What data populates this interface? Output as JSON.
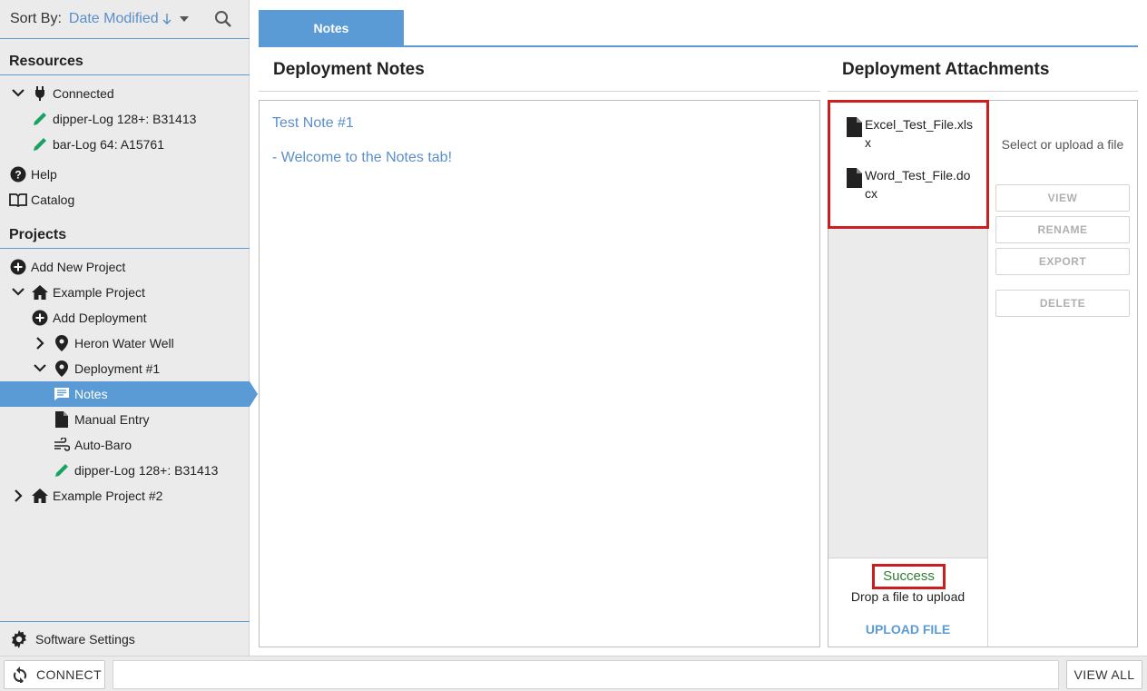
{
  "sidebar": {
    "sort": {
      "label": "Sort By:",
      "value": "Date Modified"
    },
    "resources_title": "Resources",
    "resources": [
      {
        "label": "Connected",
        "icon": "plug-icon",
        "expanded": true
      },
      {
        "label": "dipper-Log 128+: B31413",
        "icon": "pencil-icon"
      },
      {
        "label": "bar-Log 64: A15761",
        "icon": "pencil-icon"
      },
      {
        "label": "Help",
        "icon": "help-icon"
      },
      {
        "label": "Catalog",
        "icon": "book-icon"
      }
    ],
    "projects_title": "Projects",
    "projects": [
      {
        "label": "Add New Project",
        "icon": "plus-circle-icon"
      },
      {
        "label": "Example Project",
        "icon": "home-icon",
        "expanded": true
      },
      {
        "label": "Add Deployment",
        "icon": "plus-circle-icon"
      },
      {
        "label": "Heron Water Well",
        "icon": "pin-icon",
        "expanded": false
      },
      {
        "label": "Deployment #1",
        "icon": "pin-icon",
        "expanded": true
      },
      {
        "label": "Notes",
        "icon": "notes-icon",
        "selected": true
      },
      {
        "label": "Manual Entry",
        "icon": "file-icon"
      },
      {
        "label": "Auto-Baro",
        "icon": "wind-icon"
      },
      {
        "label": "dipper-Log 128+: B31413",
        "icon": "pencil-icon"
      },
      {
        "label": "Example Project #2",
        "icon": "home-icon",
        "expanded": false
      }
    ],
    "settings_label": "Software Settings"
  },
  "tabs": [
    {
      "label": "Notes",
      "active": true
    }
  ],
  "notes": {
    "title": "Deployment Notes",
    "lines": [
      "Test Note #1",
      "- Welcome to the Notes tab!"
    ]
  },
  "attachments": {
    "title": "Deployment Attachments",
    "files": [
      "Excel_Test_File.xlsx",
      "Word_Test_File.docx"
    ],
    "status": "Success",
    "drop_text": "Drop a file to upload",
    "upload_label": "UPLOAD FILE",
    "hint": "Select or upload a file",
    "buttons": {
      "view": "VIEW",
      "rename": "RENAME",
      "export": "EXPORT",
      "delete": "DELETE"
    }
  },
  "bottom": {
    "connect_label": "CONNECT",
    "view_all_label": "VIEW ALL"
  },
  "colors": {
    "accent": "#5b9bd5",
    "link_text": "#5b8fc9",
    "highlight_box": "#cc1e1e",
    "success": "#2e7d32",
    "pencil": "#1aa260"
  }
}
